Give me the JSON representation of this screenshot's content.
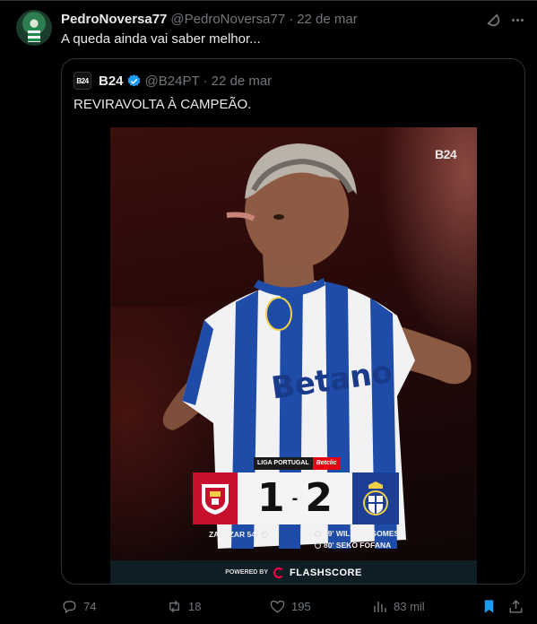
{
  "tweet": {
    "author_name": "PedroNoversa77",
    "author_handle": "@PedroNoversa77",
    "separator": "·",
    "date": "22 de mar",
    "text": "A queda ainda vai saber melhor..."
  },
  "quote": {
    "logo_text": "B24",
    "author_name": "B24",
    "author_handle": "@B24PT",
    "separator": "·",
    "date": "22 de mar",
    "text": "REVIRAVOLTA À CAMPEÃO."
  },
  "media": {
    "watermark": "B24",
    "shirt_sponsor": "Betano",
    "league_label": "LIGA PORTUGAL",
    "league_sponsor": "Betclic",
    "home_score": "1",
    "score_separator": "-",
    "away_score": "2",
    "home_scorer": "ZALAZAR 54'",
    "away_scorers": [
      "69' WILLIAM GOMES",
      "80' SEKO FOFANA"
    ],
    "powered_by": "POWERED BY",
    "provider": "FLASHSCORE",
    "colors": {
      "home": "#c8102e",
      "away": "#1c3f94",
      "flashscore": "#ff0046"
    }
  },
  "actions": {
    "replies": "74",
    "retweets": "18",
    "likes": "195",
    "views": "83 mil"
  },
  "colors": {
    "background": "#000000",
    "text": "#e7e9ea",
    "muted": "#71767b",
    "border": "#2f3336",
    "verified": "#1d9bf0",
    "bookmark_active": "#1d9bf0"
  }
}
